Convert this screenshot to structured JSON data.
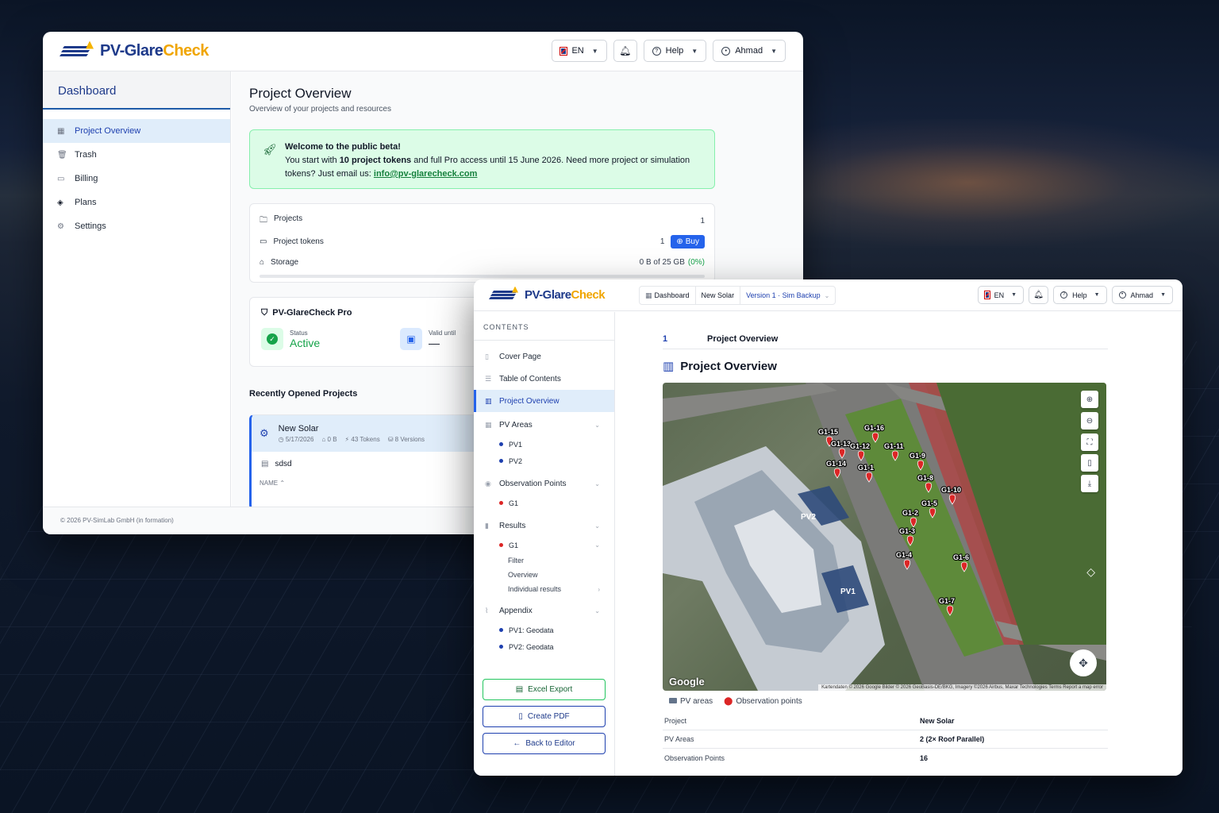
{
  "window1": {
    "logo": {
      "part1": "PV-Glare",
      "part2": "Check"
    },
    "header": {
      "lang": "EN",
      "help": "Help",
      "user": "Ahmad"
    },
    "sidebar": {
      "title": "Dashboard",
      "items": [
        {
          "label": "Project Overview",
          "icon": "grid-icon"
        },
        {
          "label": "Trash",
          "icon": "trash-icon"
        },
        {
          "label": "Billing",
          "icon": "credit-card-icon"
        },
        {
          "label": "Plans",
          "icon": "layers-icon"
        },
        {
          "label": "Settings",
          "icon": "gear-icon"
        }
      ]
    },
    "main": {
      "title": "Project Overview",
      "subtitle": "Overview of your projects and resources",
      "beta": {
        "heading": "Welcome to the public beta!",
        "line1_a": "You start with ",
        "line1_b": "10 project tokens",
        "line1_c": " and full Pro access until 15 June 2026. Need more project or simulation",
        "line2": "tokens? Just email us: ",
        "email": "info@pv-glarecheck.com"
      },
      "stats": {
        "projects_label": "Projects",
        "projects_value": "1",
        "tokens_label": "Project tokens",
        "tokens_value": "1",
        "buy": "Buy",
        "storage_label": "Storage",
        "storage_value": "0 B of 25 GB",
        "storage_pct": "(0%)",
        "storage_fraction": 0
      },
      "pro": {
        "title": "PV-GlareCheck Pro",
        "status_label": "Status",
        "status_value": "Active",
        "valid_label": "Valid until",
        "valid_value": "—"
      },
      "recent": {
        "title": "Recently Opened Projects",
        "project": {
          "name": "New Solar",
          "date": "5/17/2026",
          "size": "0 B",
          "tokens": "43 Tokens",
          "versions": "8 Versions"
        },
        "sub": "sdsd",
        "col": "NAME"
      }
    },
    "footer": "© 2026 PV-SimLab GmbH (in formation)"
  },
  "window2": {
    "logo": {
      "part1": "PV-Glare",
      "part2": "Check"
    },
    "breadcrumb": {
      "dashboard": "Dashboard",
      "project": "New Solar",
      "version": "Version 1 · Sim Backup"
    },
    "header": {
      "lang": "EN",
      "help": "Help",
      "user": "Ahmad"
    },
    "contents_title": "CONTENTS",
    "toc": {
      "cover": "Cover Page",
      "toc": "Table of Contents",
      "overview": "Project Overview",
      "pv_areas": "PV Areas",
      "pv1": "PV1",
      "pv2": "PV2",
      "obs": "Observation Points",
      "g1": "G1",
      "results": "Results",
      "results_g1": "G1",
      "filter": "Filter",
      "r_overview": "Overview",
      "individual": "Individual results",
      "appendix": "Appendix",
      "pv1_geo": "PV1: Geodata",
      "pv2_geo": "PV2: Geodata"
    },
    "actions": {
      "excel": "Excel Export",
      "pdf": "Create PDF",
      "back": "Back to Editor"
    },
    "section": {
      "number": "1",
      "title": "Project Overview"
    },
    "heading": "Project Overview",
    "map": {
      "google": "Google",
      "attribution": "Kartendaten © 2026 Google Bilder © 2026 GeoBasis-DE/BKG, Imagery ©2026 Airbus, Maxar Technologies   Terms   Report a map error",
      "areas": [
        "PV2",
        "PV1"
      ],
      "points": [
        "G1-15",
        "G1-16",
        "G1-13",
        "G1-12",
        "G1-11",
        "G1-14",
        "G1-1",
        "G1-9",
        "G1-8",
        "G1-10",
        "G1-5",
        "G1-2",
        "G1-3",
        "G1-4",
        "G1-6",
        "G1-7"
      ],
      "pv_color": "#1e40af",
      "point_color": "#dc2626"
    },
    "legend": {
      "pv": "PV areas",
      "obs": "Observation points"
    },
    "table": [
      {
        "k": "Project",
        "v": "New Solar"
      },
      {
        "k": "PV Areas",
        "v": "2 (2× Roof Parallel)"
      },
      {
        "k": "Observation Points",
        "v": "16"
      }
    ]
  }
}
